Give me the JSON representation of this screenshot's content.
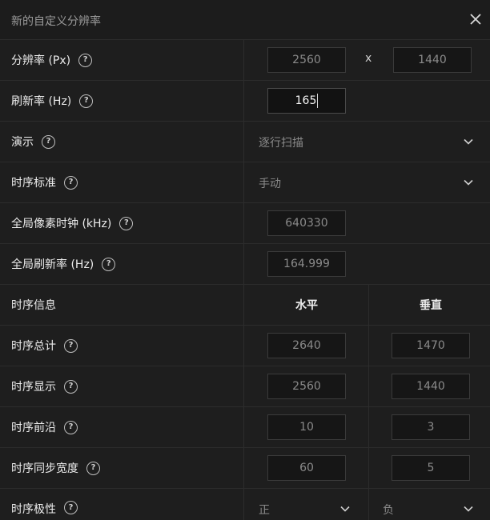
{
  "dialog": {
    "title": "新的自定义分辨率",
    "close_icon": "close-icon"
  },
  "resolution": {
    "label": "分辨率 (Px)",
    "width": "2560",
    "separator": "x",
    "height": "1440"
  },
  "refresh": {
    "label": "刷新率 (Hz)",
    "value": "165"
  },
  "scan": {
    "label": "演示",
    "value": "逐行扫描"
  },
  "timing_standard": {
    "label": "时序标准",
    "value": "手动"
  },
  "pixel_clock": {
    "label": "全局像素时钟 (kHz)",
    "value": "640330"
  },
  "global_refresh": {
    "label": "全局刷新率 (Hz)",
    "value": "164.999"
  },
  "timing_info": {
    "label": "时序信息",
    "horizontal": "水平",
    "vertical": "垂直"
  },
  "timing_total": {
    "label": "时序总计",
    "horizontal": "2640",
    "vertical": "1470"
  },
  "timing_display": {
    "label": "时序显示",
    "horizontal": "2560",
    "vertical": "1440"
  },
  "front_porch": {
    "label": "时序前沿",
    "horizontal": "10",
    "vertical": "3"
  },
  "sync_width": {
    "label": "时序同步宽度",
    "horizontal": "60",
    "vertical": "5"
  },
  "polarity": {
    "label": "时序极性",
    "horizontal": "正",
    "vertical": "负"
  },
  "colors": {
    "background": "#161616",
    "row": "#1e1e1e",
    "border": "#2c2c2c"
  }
}
